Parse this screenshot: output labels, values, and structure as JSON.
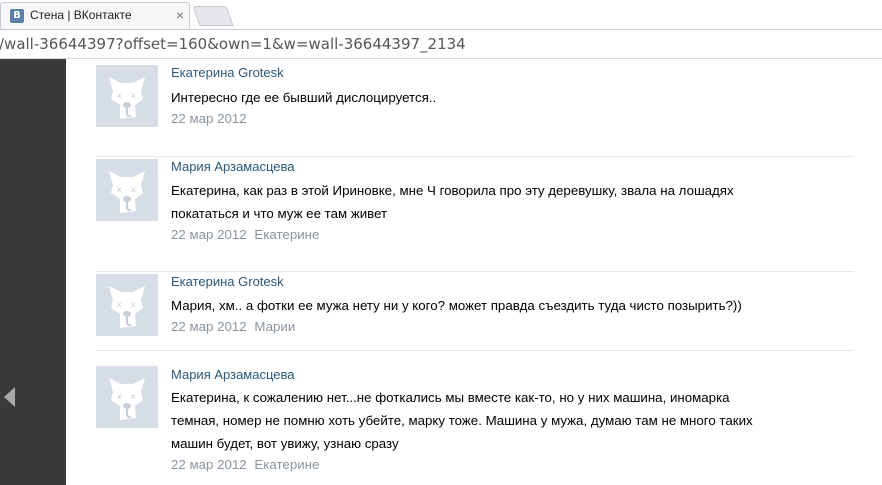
{
  "tab": {
    "favicon": "В",
    "title": "Стена | ВКонтакте",
    "close": "×"
  },
  "address": {
    "url": "/wall-36644397?offset=160&own=1&w=wall-36644397_2134"
  },
  "comments": [
    {
      "author": "Екатерина Grotesk",
      "text": "Интересно где ее бывший дислоцируется..",
      "date": "22 мар 2012",
      "reply_to": ""
    },
    {
      "author": "Мария Арзамасцева",
      "text": "Екатерина, как раз в этой Ириновке, мне Ч говорила про эту деревушку, звала на лошадях покататься и что муж ее там живет",
      "date": "22 мар 2012",
      "reply_to": "Екатерине"
    },
    {
      "author": "Екатерина Grotesk",
      "text": "Мария, хм.. а фотки ее мужа нету ни у кого? может правда съездить туда чисто позырить?))",
      "date": "22 мар 2012",
      "reply_to": "Марии"
    },
    {
      "author": "Мария Арзамасцева",
      "text": "Екатерина, к сожалению нет...не фоткались мы вместе как-то, но у них машина, иномарка темная, номер не помню хоть убейте, марку тоже. Машина у мужа, думаю там не много таких машин будет, вот увижу, узнаю сразу",
      "date": "22 мар 2012",
      "reply_to": "Екатерине"
    }
  ],
  "icons": {
    "avatar": "deactivated-dog-avatar-icon",
    "back": "back-arrow-icon",
    "new_tab": "new-tab-button"
  },
  "colors": {
    "link": "#2b587a",
    "meta": "#8a95a0",
    "avatar_bg": "#d6dde6",
    "side_panel": "#3a3a3a"
  }
}
